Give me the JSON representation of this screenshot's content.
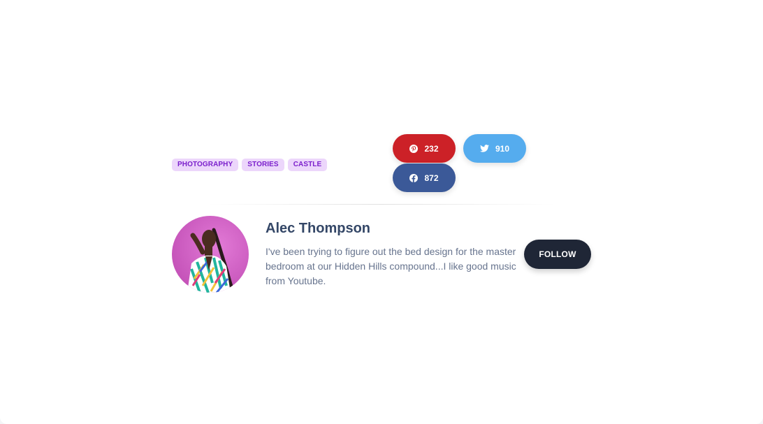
{
  "tags": [
    "Photography",
    "Stories",
    "Castle"
  ],
  "social": {
    "pinterest": {
      "count": "232",
      "icon": "pinterest-icon",
      "color": "#cc2127"
    },
    "twitter": {
      "count": "910",
      "icon": "twitter-icon",
      "color": "#55acee"
    },
    "facebook": {
      "count": "872",
      "icon": "facebook-icon",
      "color": "#3b5998"
    }
  },
  "author": {
    "name": "Alec Thompson",
    "bio": "I've been trying to figure out the bed design for the master bedroom at our Hidden Hills compound...I like good music from Youtube.",
    "follow_label": "FOLLOW"
  },
  "colors": {
    "tag_bg": "#ecd6fb",
    "tag_text": "#7b1fcc",
    "heading": "#344767",
    "body_text": "#67748e",
    "follow_bg": "#1f2636"
  }
}
